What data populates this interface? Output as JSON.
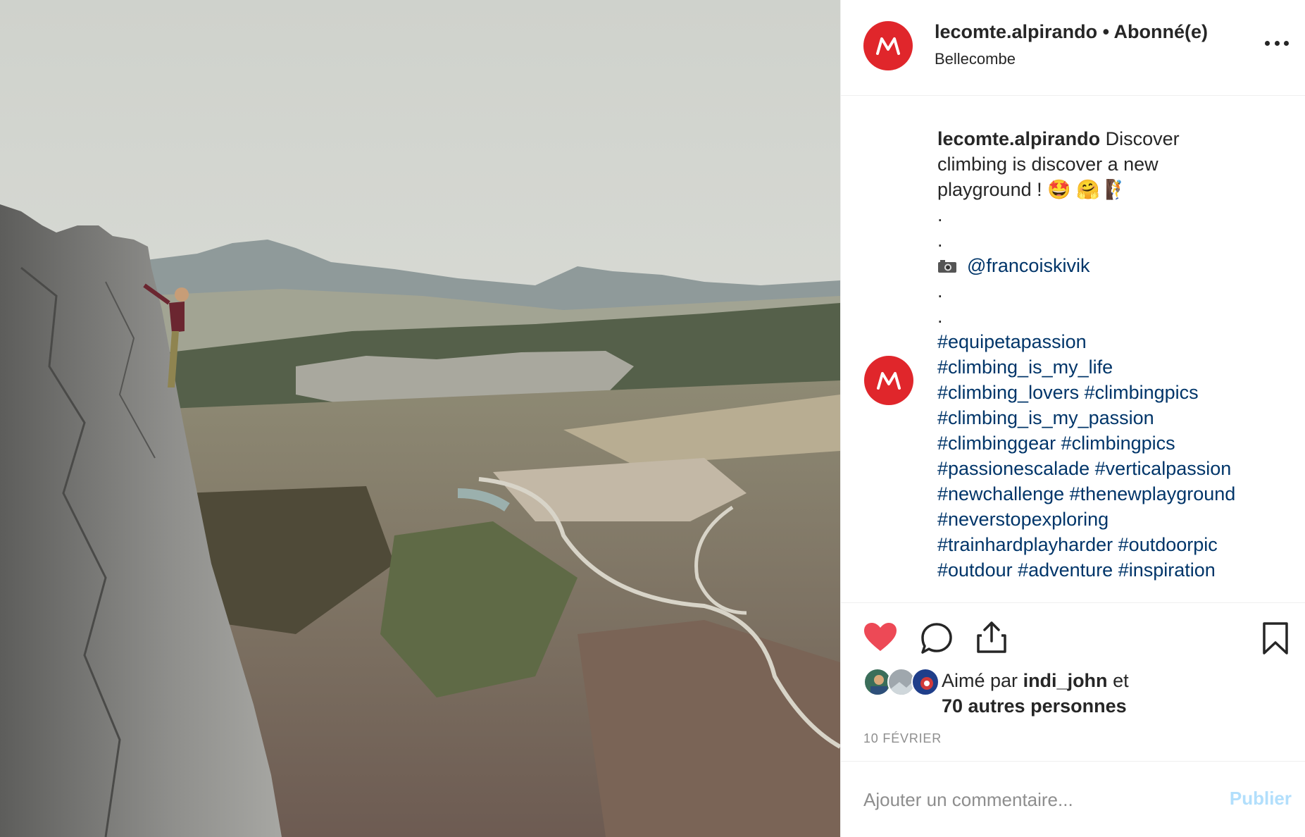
{
  "post": {
    "photo_alt": "",
    "header": {
      "username": "lecomte.alpirando",
      "separator": " • ",
      "follow_status": "Abonné(e)",
      "location": "Bellecombe"
    },
    "caption": {
      "username": "lecomte.alpirando",
      "text_lines": [
        "Discover",
        "climbing is discover a new",
        "playground ! 🤩 🤗 🧗"
      ],
      "dot": ".",
      "mention": "@francoiskivik",
      "hashtag_lines": [
        "#equipetapassion",
        "#climbing_is_my_life",
        "#climbing_lovers #climbingpics",
        "#climbing_is_my_passion",
        "#climbinggear #climbingpics",
        "#passionescalade #verticalpassion",
        "#newchallenge #thenewplayground",
        "#neverstopexploring",
        "#trainhardplayharder #outdoorpic",
        "#outdour #adventure #inspiration"
      ]
    },
    "likes": {
      "prefix": "Aimé par",
      "user": "indi_john",
      "connector": "et",
      "others": "70 autres personnes"
    },
    "date": "10 FÉVRIER",
    "comment": {
      "placeholder": "Ajouter un commentaire...",
      "publish_label": "Publier"
    }
  },
  "colors": {
    "brand_avatar": "#e0262b",
    "like_heart": "#ed4956",
    "hashtag": "#003569",
    "publish_disabled": "#b2dffc",
    "muted": "#8e8e8e"
  },
  "icons": [
    "more-icon",
    "heart-icon",
    "comment-icon",
    "share-icon",
    "bookmark-icon",
    "camera-icon"
  ]
}
